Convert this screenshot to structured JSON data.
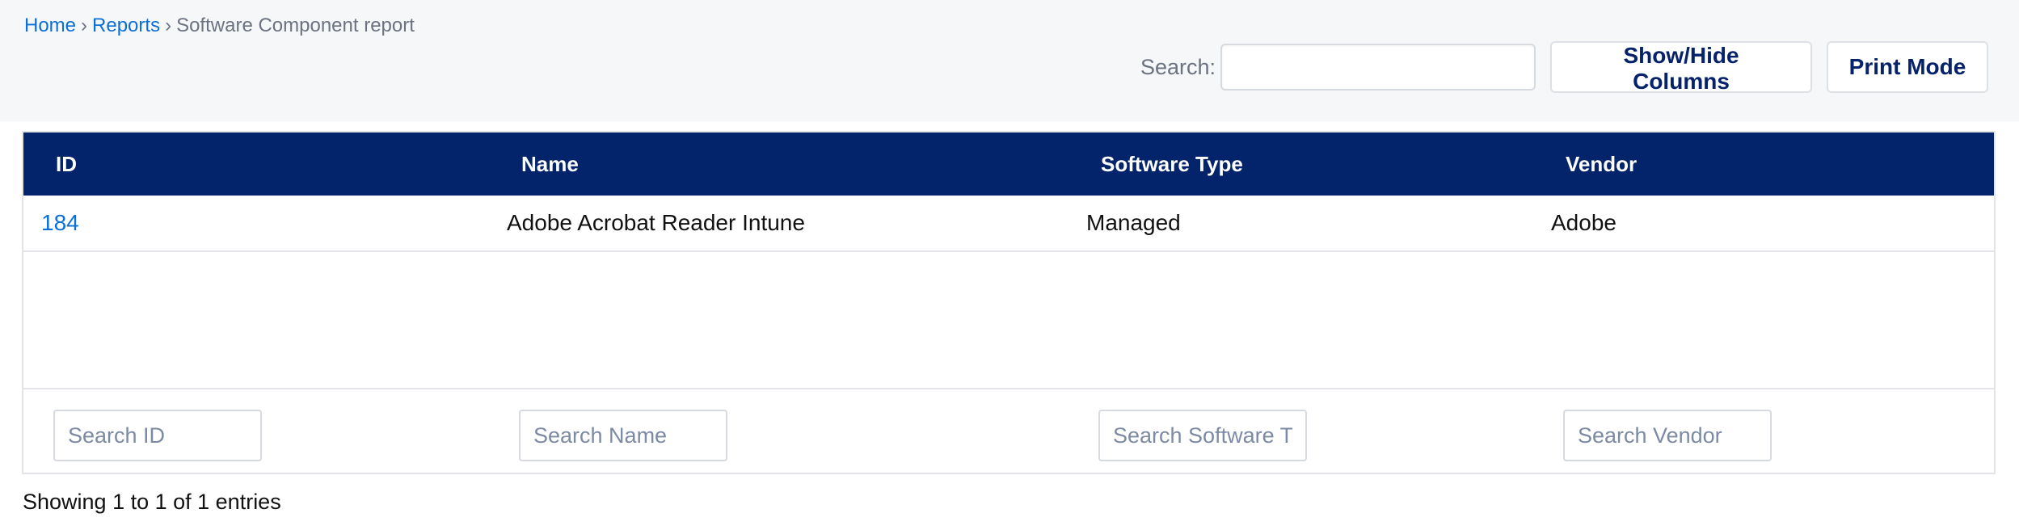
{
  "breadcrumb": {
    "home": "Home",
    "reports": "Reports",
    "current": "Software Component report",
    "separator": "›"
  },
  "toolbar": {
    "search_label": "Search:",
    "search_value": "",
    "show_hide_label": "Show/Hide Columns",
    "print_label": "Print Mode"
  },
  "table": {
    "columns": [
      "ID",
      "Name",
      "Software Type",
      "Vendor"
    ],
    "rows": [
      {
        "id": "184",
        "name": "Adobe Acrobat Reader Intune",
        "software_type": "Managed",
        "vendor": "Adobe"
      }
    ],
    "column_search_placeholders": [
      "Search ID",
      "Search Name",
      "Search Software Type",
      "Search Vendor"
    ]
  },
  "info": "Showing 1 to 1 of 1 entries",
  "colors": {
    "header_bg": "#03246b",
    "link": "#0b6fd6",
    "button_text": "#05226b"
  }
}
